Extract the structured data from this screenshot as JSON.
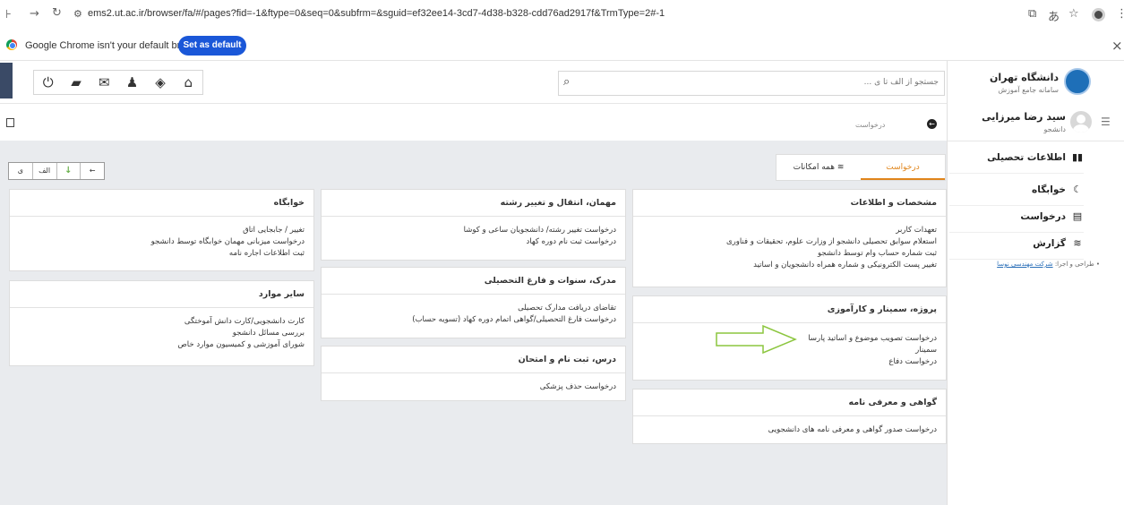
{
  "browser": {
    "url": "ems2.ut.ac.ir/browser/fa/#/pages?fid=-1&ftype=0&seq=0&subfrm=&sguid=ef32ee14-3cd7-4d38-b328-cdd76ad2917f&TrmType=2#-1",
    "infobar_message": "Google Chrome isn't your default browser",
    "set_default_label": "Set as default"
  },
  "header": {
    "search_placeholder": "جستجو از الف تا ی ..."
  },
  "sidebar": {
    "university_name": "دانشگاه تهران",
    "system_name": "سامانه جامع آموزش",
    "user_name": "سید رضا میرزایی",
    "user_role": "دانشجو",
    "items": [
      {
        "label": "اطلاعات تحصیلی",
        "icon": "book-icon"
      },
      {
        "label": "خوابگاه",
        "icon": "moon-icon"
      },
      {
        "label": "درخواست",
        "icon": "form-icon"
      },
      {
        "label": "گزارش",
        "icon": "layers-icon"
      }
    ],
    "credits_prefix": "طراحی و اجرا:",
    "credits_link": "شرکت مهندسی نوسا"
  },
  "content": {
    "breadcrumb": "درخواست",
    "tabs": [
      "درخواست",
      "همه امکانات"
    ],
    "sort_buttons": [
      "←",
      "↓",
      "الف",
      "ی"
    ],
    "cards": {
      "identity": {
        "title": "مشخصات و اطلاعات",
        "items": [
          "تعهدات کاربر",
          "استعلام سوابق تحصیلی دانشجو از وزارت علوم، تحقیقات و فناوری",
          "ثبت شماره حساب وام توسط دانشجو",
          "تغییر پست الکترونیکی و شماره همراه دانشجویان و اساتید"
        ]
      },
      "project": {
        "title": "پروژه، سمینار و کارآموزی",
        "items": [
          "درخواست تصویب موضوع و اساتید پارسا",
          "سمینار",
          "درخواست دفاع"
        ]
      },
      "certificate": {
        "title": "گواهی و معرفی نامه",
        "items": [
          "درخواست صدور گواهی و معرفی نامه های دانشجویی"
        ]
      },
      "transfer": {
        "title": "مهمان، انتقال و تغییر رشته",
        "items": [
          "درخواست تغییر رشته/ دانشجویان ساعی و کوشا",
          "درخواست ثبت نام دوره کهاد"
        ]
      },
      "degree": {
        "title": "مدرک، سنوات و فارغ التحصیلی",
        "items": [
          "تقاضای دریافت مدارک تحصیلی",
          "درخواست فارغ التحصیلی/گواهی اتمام دوره کهاد (تسویه حساب)"
        ]
      },
      "course": {
        "title": "درس، ثبت نام و امتحان",
        "items": [
          "درخواست حذف پزشکی"
        ]
      },
      "dorm": {
        "title": "خوابگاه",
        "items": [
          "تغییر / جابجایی اتاق",
          "درخواست میزبانی مهمان خوابگاه توسط دانشجو",
          "ثبت اطلاعات اجاره نامه"
        ]
      },
      "other": {
        "title": "سایر موارد",
        "items": [
          "کارت دانشجویی/کارت دانش آموختگی",
          "بررسی مسائل دانشجو",
          "شورای آموزشی و کمیسیون موارد خاص"
        ]
      }
    }
  },
  "colors": {
    "accent_tab": "#e0851b",
    "arrow_annotation": "#8cc63f",
    "set_default_button": "#1a57d8",
    "uni_logo": "#1e6fb8"
  }
}
